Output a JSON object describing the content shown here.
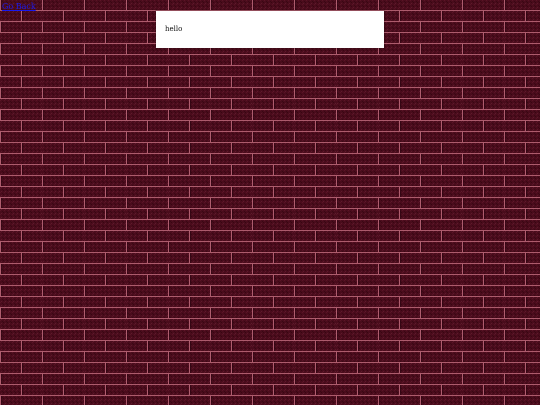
{
  "window": {
    "background_color": "#4a0c1c",
    "brick_color": "#4a0c1c",
    "mortar_color": "#c06a7c"
  },
  "top_link": {
    "label": "Go Back"
  },
  "message_box": {
    "text": "hello"
  }
}
